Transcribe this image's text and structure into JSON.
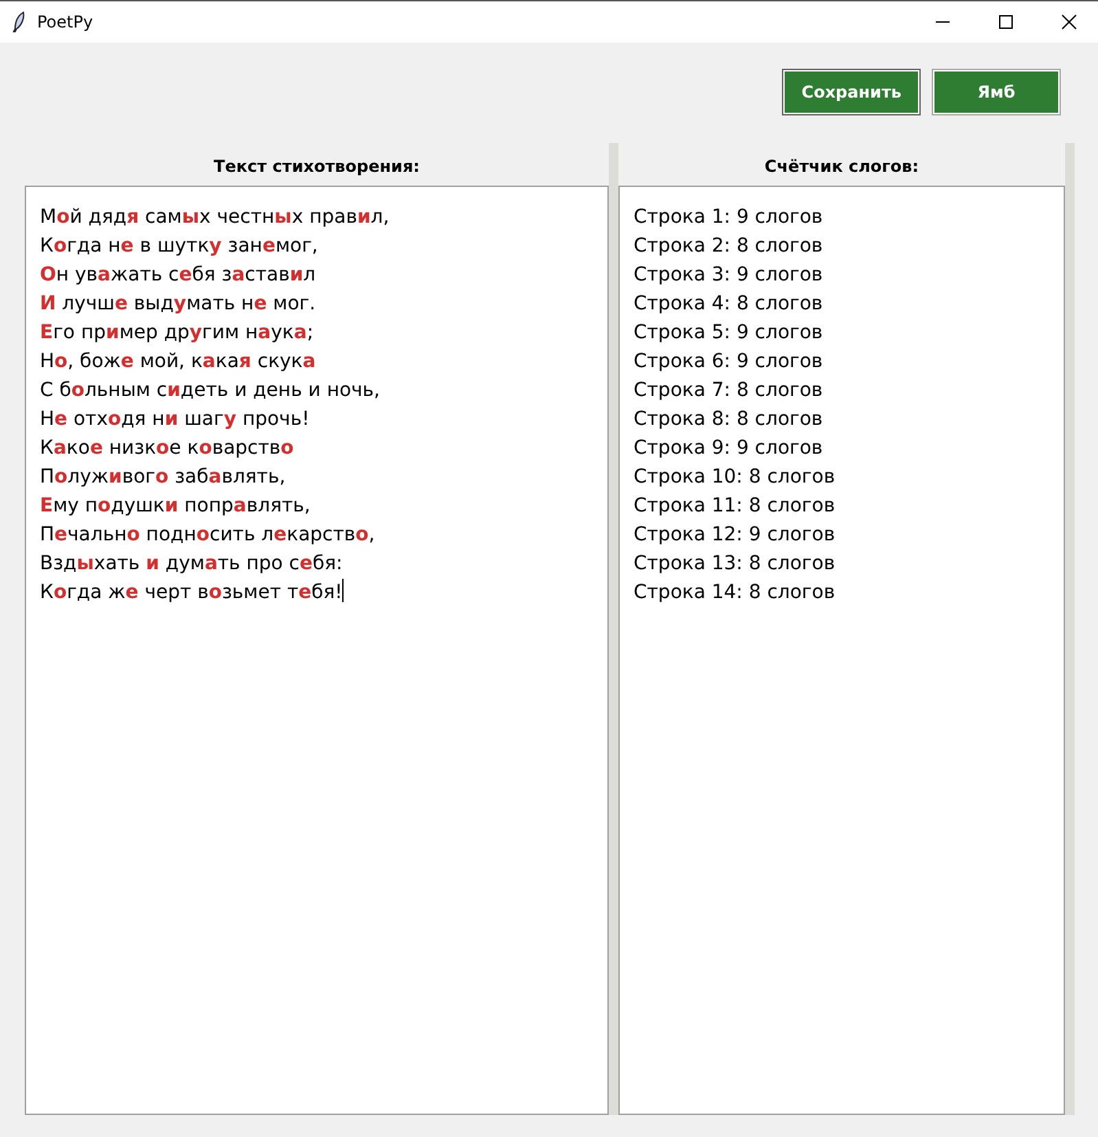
{
  "window": {
    "title": "PoetPy"
  },
  "buttons": [
    {
      "label": "Сохранить",
      "selected": true
    },
    {
      "label": "Ямб",
      "selected": false
    }
  ],
  "poem_panel": {
    "heading": "Текст стихотворения:",
    "lines": [
      "М**о**й дяд**я** сам**ы**х честн**ы**х прав**и**л,",
      "К**о**гда н**е** в шутк**у** зан**е**мог,",
      "**О**н ув**а**жать с**е**бя з**а**став**и**л",
      "**И** лучш**е** выд**у**мать н**е** мог.",
      "**Е**го пр**и**мер др**у**гим н**а**ук**а**;",
      "Н**о**, бож**е** мой, к**а**ка**я** скук**а**",
      "С б**о**льным с**и**деть и день и ночь,",
      "Н**е** отх**о**дя н**и** шаг**у** прочь!",
      "К**а**ко**е** низк**о**е к**о**варств**о**",
      "П**о**луж**и**вог**о** заб**а**влять,",
      "**Е**му п**о**душк**и** попр**а**влять,",
      "П**е**чальн**о** подн**о**сить л**е**карств**о**,",
      "Взд**ы**хать **и** дум**а**ть про с**е**бя:",
      "К**о**гда ж**е** черт в**о**зьмет т**е**бя!"
    ]
  },
  "counter_panel": {
    "heading": "Счётчик слогов:",
    "lines": [
      "Строка 1: 9 слогов",
      "Строка 2: 8 слогов",
      "Строка 3: 9 слогов",
      "Строка 4: 8 слогов",
      "Строка 5: 9 слогов",
      "Строка 6: 9 слогов",
      "Строка 7: 8 слогов",
      "Строка 8: 8 слогов",
      "Строка 9: 9 слогов",
      "Строка 10: 8 слогов",
      "Строка 11: 8 слогов",
      "Строка 12: 9 слогов",
      "Строка 13: 8 слогов",
      "Строка 14: 8 слогов"
    ]
  }
}
